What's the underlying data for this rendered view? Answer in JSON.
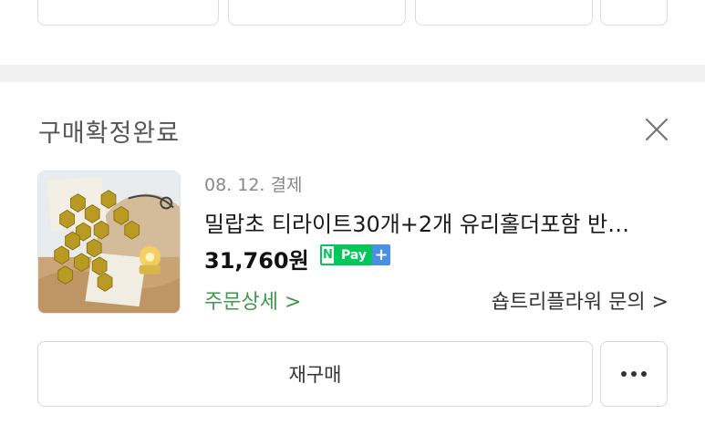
{
  "top_buttons": [
    {
      "label": "",
      "icon": ""
    },
    {
      "label": "",
      "icon": ""
    },
    {
      "label": "",
      "icon": ""
    },
    {
      "label": "",
      "icon": ""
    }
  ],
  "order": {
    "status": "구매확정완료",
    "close_icon": "close-icon",
    "date": "08. 12. 결제",
    "product_name": "밀랍초 티라이트30개+2개 유리홀더포함 반…",
    "price": "31,760원",
    "pay_badge": {
      "n": "N",
      "pay": "Pay",
      "plus": "+",
      "colors": {
        "green": "#03c75a",
        "blue": "#4a90e2"
      }
    },
    "order_detail": "주문상세 >",
    "seller_inquiry": "숍트리플라워 문의 >",
    "rebuy_label": "재구매",
    "more_icon": "more-icon"
  },
  "colors": {
    "accent_green": "#3e9a4b",
    "divider": "#f1f1f3"
  }
}
